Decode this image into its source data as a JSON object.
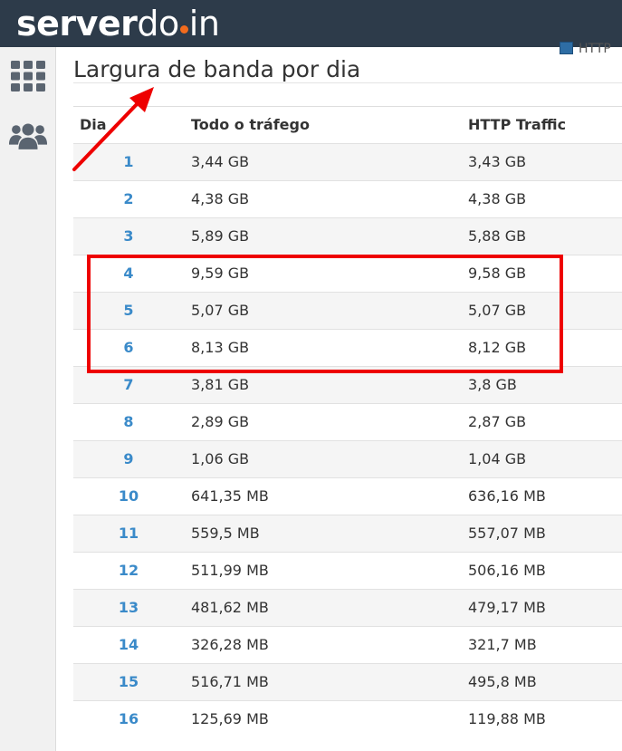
{
  "brand": {
    "logo_part1": "server",
    "logo_part2": "do",
    "logo_part3": "in",
    "dot_color": "#f26b1d"
  },
  "sidebar": {
    "items": [
      {
        "icon": "grid-icon"
      },
      {
        "icon": "users-icon"
      }
    ]
  },
  "legend": {
    "label": "HTTP"
  },
  "page": {
    "title": "Largura de banda por dia"
  },
  "table": {
    "headers": {
      "day": "Dia",
      "all": "Todo o tráfego",
      "http": "HTTP Traffic"
    },
    "rows": [
      {
        "day": "1",
        "all": "3,44 GB",
        "http": "3,43 GB"
      },
      {
        "day": "2",
        "all": "4,38 GB",
        "http": "4,38 GB"
      },
      {
        "day": "3",
        "all": "5,89 GB",
        "http": "5,88 GB"
      },
      {
        "day": "4",
        "all": "9,59 GB",
        "http": "9,58 GB"
      },
      {
        "day": "5",
        "all": "5,07 GB",
        "http": "5,07 GB"
      },
      {
        "day": "6",
        "all": "8,13 GB",
        "http": "8,12 GB"
      },
      {
        "day": "7",
        "all": "3,81 GB",
        "http": "3,8 GB"
      },
      {
        "day": "8",
        "all": "2,89 GB",
        "http": "2,87 GB"
      },
      {
        "day": "9",
        "all": "1,06 GB",
        "http": "1,04 GB"
      },
      {
        "day": "10",
        "all": "641,35 MB",
        "http": "636,16 MB"
      },
      {
        "day": "11",
        "all": "559,5 MB",
        "http": "557,07 MB"
      },
      {
        "day": "12",
        "all": "511,99 MB",
        "http": "506,16 MB"
      },
      {
        "day": "13",
        "all": "481,62 MB",
        "http": "479,17 MB"
      },
      {
        "day": "14",
        "all": "326,28 MB",
        "http": "321,7 MB"
      },
      {
        "day": "15",
        "all": "516,71 MB",
        "http": "495,8 MB"
      },
      {
        "day": "16",
        "all": "125,69 MB",
        "http": "119,88 MB"
      }
    ]
  },
  "annotations": {
    "color": "#ee0000"
  }
}
